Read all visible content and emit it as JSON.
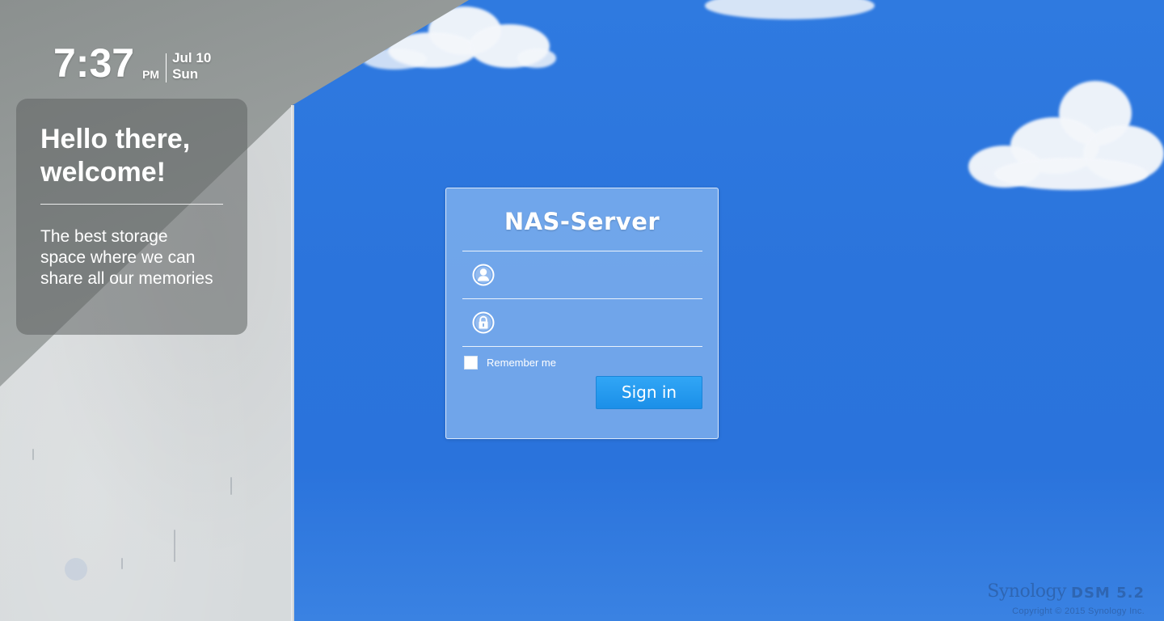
{
  "clock": {
    "time": "7:37",
    "ampm": "PM",
    "date_line1": "Jul 10",
    "date_line2": "Sun"
  },
  "welcome": {
    "title_line1": "Hello there,",
    "title_line2": "welcome!",
    "text": "The best storage space where we can share all our memories"
  },
  "login": {
    "title": "NAS-Server",
    "username": {
      "icon": "user-icon",
      "value": "",
      "placeholder": ""
    },
    "password": {
      "icon": "lock-icon",
      "value": "",
      "placeholder": ""
    },
    "remember_label": "Remember me",
    "remember_checked": false,
    "signin_label": "Sign in"
  },
  "brand": {
    "name": "Synology",
    "version": "DSM 5.2",
    "copyright": "Copyright © 2015 Synology Inc."
  },
  "colors": {
    "sky": "#2b74dc",
    "button": "#1f94ec",
    "wall": "#d6dadc"
  }
}
